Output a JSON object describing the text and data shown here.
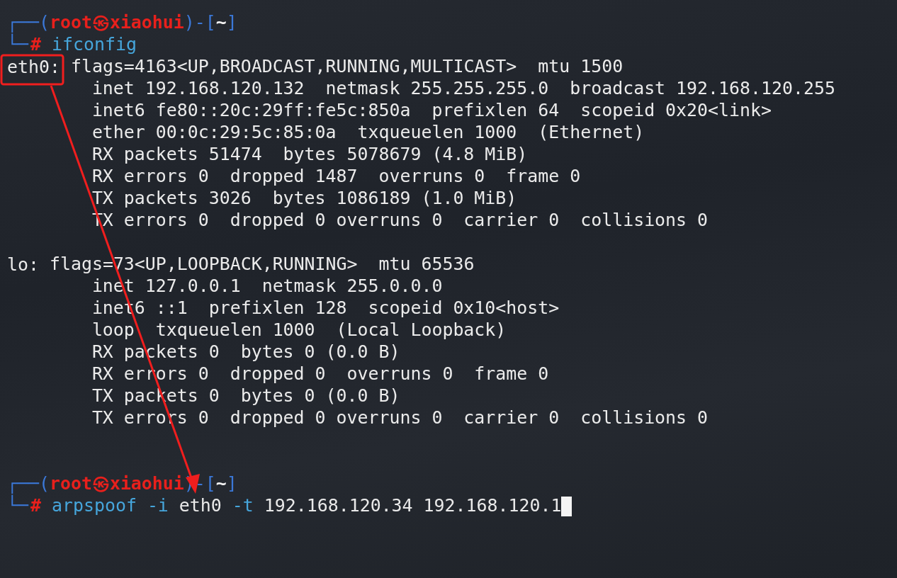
{
  "terminal": {
    "lines": [
      {
        "kind": "prompt",
        "parts": [
          {
            "kind": "frame",
            "text": "┌──("
          },
          {
            "kind": "user",
            "text": "root㉿xiaohui"
          },
          {
            "kind": "frame",
            "text": ")-["
          },
          {
            "kind": "dir",
            "text": "~"
          },
          {
            "kind": "frame",
            "text": "]"
          }
        ]
      },
      {
        "kind": "command",
        "cursor": false,
        "parts": [
          {
            "kind": "frame",
            "text": "└─"
          },
          {
            "kind": "hash",
            "text": "#"
          },
          {
            "kind": "program",
            "text": "ifconfig"
          }
        ]
      },
      {
        "kind": "interface",
        "name": "eth0:",
        "text": "flags=4163<UP,BROADCAST,RUNNING,MULTICAST>  mtu 1500"
      },
      {
        "kind": "output",
        "text": "        inet 192.168.120.132  netmask 255.255.255.0  broadcast 192.168.120.255"
      },
      {
        "kind": "output",
        "text": "        inet6 fe80::20c:29ff:fe5c:850a  prefixlen 64  scopeid 0x20<link>"
      },
      {
        "kind": "output",
        "text": "        ether 00:0c:29:5c:85:0a  txqueuelen 1000  (Ethernet)"
      },
      {
        "kind": "output",
        "text": "        RX packets 51474  bytes 5078679 (4.8 MiB)"
      },
      {
        "kind": "output",
        "text": "        RX errors 0  dropped 1487  overruns 0  frame 0"
      },
      {
        "kind": "output",
        "text": "        TX packets 3026  bytes 1086189 (1.0 MiB)"
      },
      {
        "kind": "output",
        "text": "        TX errors 0  dropped 0 overruns 0  carrier 0  collisions 0"
      },
      {
        "kind": "blank"
      },
      {
        "kind": "interface",
        "name": "lo:",
        "text": "flags=73<UP,LOOPBACK,RUNNING>  mtu 65536"
      },
      {
        "kind": "output",
        "text": "        inet 127.0.0.1  netmask 255.0.0.0"
      },
      {
        "kind": "output",
        "text": "        inet6 ::1  prefixlen 128  scopeid 0x10<host>"
      },
      {
        "kind": "output",
        "text": "        loop  txqueuelen 1000  (Local Loopback)"
      },
      {
        "kind": "output",
        "text": "        RX packets 0  bytes 0 (0.0 B)"
      },
      {
        "kind": "output",
        "text": "        RX errors 0  dropped 0  overruns 0  frame 0"
      },
      {
        "kind": "output",
        "text": "        TX packets 0  bytes 0 (0.0 B)"
      },
      {
        "kind": "output",
        "text": "        TX errors 0  dropped 0 overruns 0  carrier 0  collisions 0"
      },
      {
        "kind": "blank"
      },
      {
        "kind": "blank"
      },
      {
        "kind": "prompt",
        "parts": [
          {
            "kind": "frame",
            "text": "┌──("
          },
          {
            "kind": "user",
            "text": "root㉿xiaohui"
          },
          {
            "kind": "frame",
            "text": ")-["
          },
          {
            "kind": "dir",
            "text": "~"
          },
          {
            "kind": "frame",
            "text": "]"
          }
        ]
      },
      {
        "kind": "command",
        "cursor": true,
        "parts": [
          {
            "kind": "frame",
            "text": "└─"
          },
          {
            "kind": "hash",
            "text": "#"
          },
          {
            "kind": "program",
            "text": "arpspoof"
          },
          {
            "kind": "option",
            "text": "-i"
          },
          {
            "kind": "arg",
            "text": "eth0"
          },
          {
            "kind": "option",
            "text": "-t"
          },
          {
            "kind": "arg",
            "text": "192.168.120.34"
          },
          {
            "kind": "arg",
            "text": "192.168.120.1"
          }
        ]
      }
    ]
  },
  "annotations": [
    {
      "kind": "box"
    },
    {
      "kind": "arrow"
    }
  ]
}
